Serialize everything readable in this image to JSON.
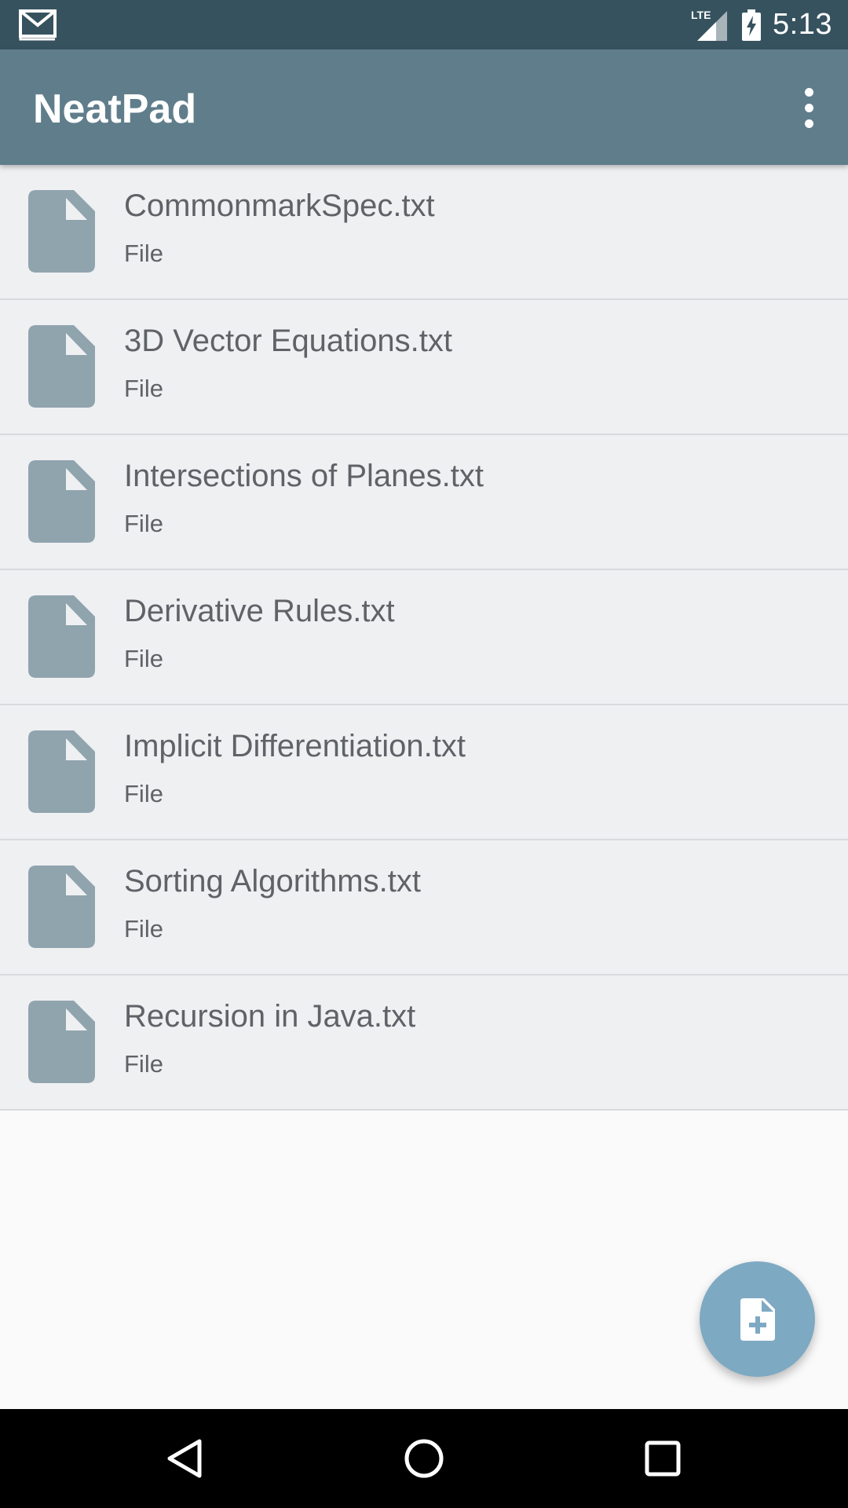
{
  "status_bar": {
    "network": "LTE",
    "time": "5:13",
    "icons": [
      "gmail-icon",
      "lte-signal-icon",
      "battery-charging-icon"
    ]
  },
  "app_bar": {
    "title": "NeatPad",
    "overflow_icon": "more-vert-icon"
  },
  "files": [
    {
      "name": "CommonmarkSpec.txt",
      "type": "File"
    },
    {
      "name": "3D Vector Equations.txt",
      "type": "File"
    },
    {
      "name": "Intersections of Planes.txt",
      "type": "File"
    },
    {
      "name": "Derivative Rules.txt",
      "type": "File"
    },
    {
      "name": "Implicit Differentiation.txt",
      "type": "File"
    },
    {
      "name": "Sorting Algorithms.txt",
      "type": "File"
    },
    {
      "name": "Recursion in Java.txt",
      "type": "File"
    }
  ],
  "fab": {
    "icon": "note-add-icon"
  },
  "nav_bar": {
    "icons": [
      "back-icon",
      "home-icon",
      "recents-icon"
    ]
  },
  "colors": {
    "status_bar": "#37525f",
    "app_bar": "#607d8b",
    "row_background": "#eff0f2",
    "file_icon": "#90a4ae",
    "fab": "#7ea9c3",
    "text": "#5f6367"
  }
}
